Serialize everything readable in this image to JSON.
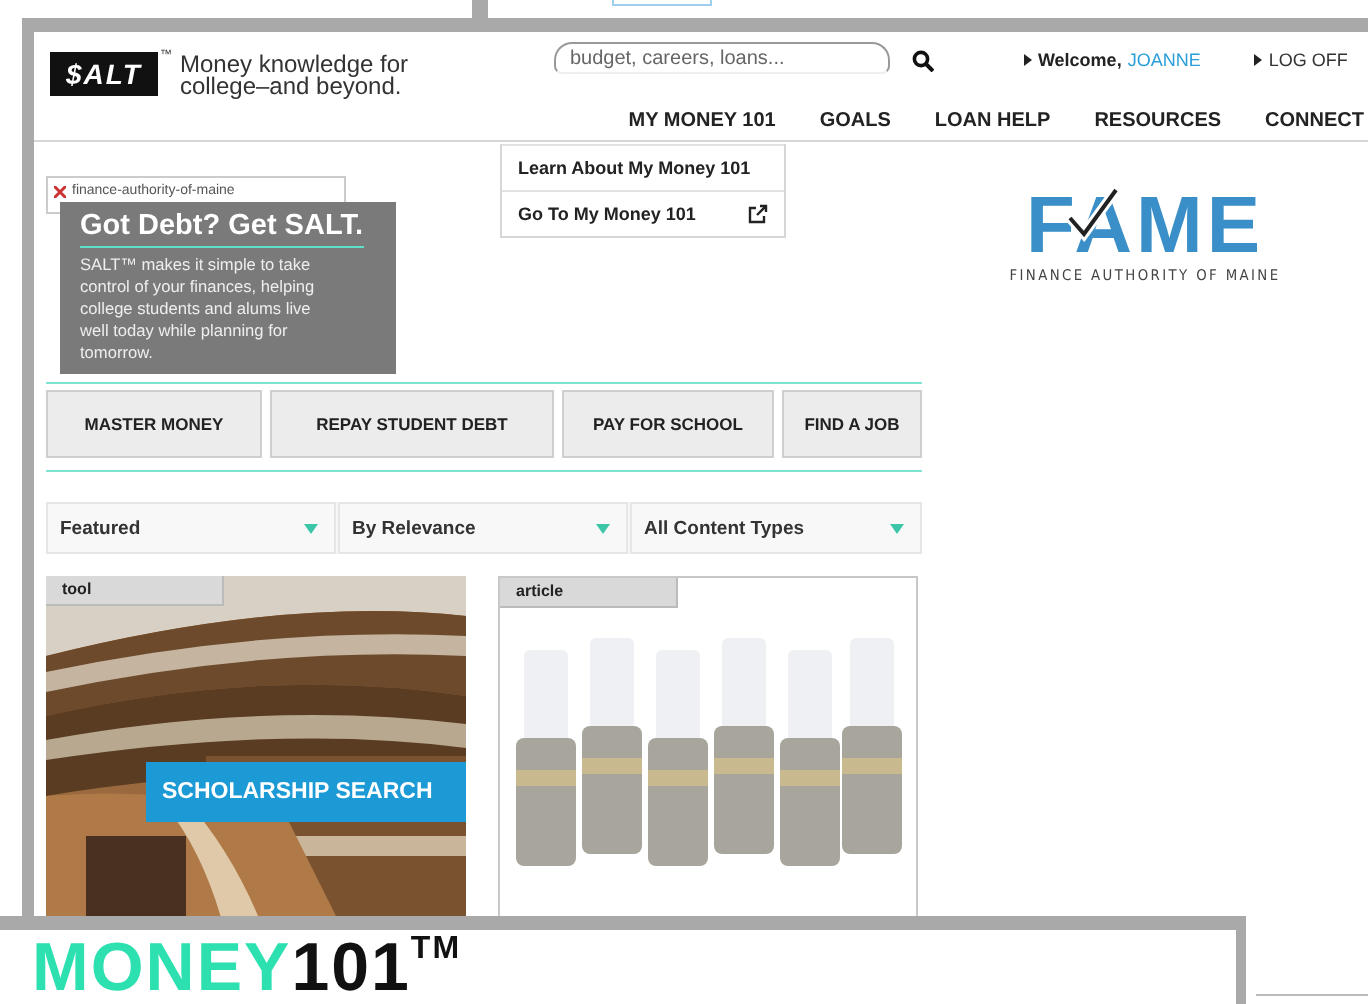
{
  "header": {
    "logo": "$ALT",
    "logo_mark": "™",
    "tagline": "Money knowledge for college–and beyond.",
    "search": {
      "placeholder": "budget, careers, loans..."
    },
    "welcome": "Welcome,",
    "user": "JOANNE",
    "logoff": "LOG OFF"
  },
  "nav": [
    {
      "label": "MY MONEY 101",
      "dropdown": [
        {
          "label": "Learn About My Money 101",
          "external": false
        },
        {
          "label": "Go To My Money 101",
          "external": true
        }
      ]
    },
    {
      "label": "GOALS"
    },
    {
      "label": "LOAN HELP"
    },
    {
      "label": "RESOURCES"
    },
    {
      "label": "CONNECT"
    }
  ],
  "broken_image": {
    "alt": "finance-authority-of-maine"
  },
  "promo": {
    "title": "Got Debt? Get SALT.",
    "text": "SALT™ makes it simple to take control of your finances, helping college students and alums live well today while planning for tomorrow."
  },
  "partner_logo": {
    "name": "FAME",
    "subtitle": "FINANCE AUTHORITY OF MAINE"
  },
  "topics": [
    "MASTER MONEY",
    "REPAY STUDENT DEBT",
    "PAY FOR SCHOOL",
    "FIND A JOB"
  ],
  "filters": [
    "Featured",
    "By Relevance",
    "All Content Types"
  ],
  "cards": [
    {
      "tag": "tool",
      "overlay": "SCHOLARSHIP SEARCH"
    },
    {
      "tag": "article"
    }
  ],
  "banner": {
    "parts": [
      {
        "text": "MONEY",
        "color": "#2de0b0"
      },
      {
        "text": "101$^{TM}$",
        "color": "#111111"
      }
    ]
  }
}
